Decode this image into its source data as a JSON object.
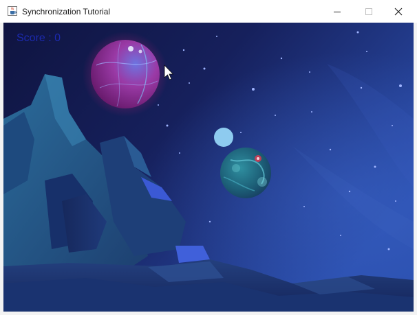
{
  "window": {
    "title": "Synchronization Tutorial",
    "icon": "java-cup-icon",
    "controls": [
      "minimize-icon",
      "maximize-icon",
      "close-icon"
    ]
  },
  "game": {
    "score_text": "Score : 0",
    "score_color": "#1c2ab0",
    "background": "space-scene",
    "sky_colors": [
      "#10143f",
      "#1c2a78",
      "#2a4fb0"
    ],
    "sprites": [
      "pink-planet",
      "teal-planet",
      "light-blue-ball",
      "rock-formations",
      "mouse-cursor"
    ],
    "ball_color": "#8ecbef"
  }
}
